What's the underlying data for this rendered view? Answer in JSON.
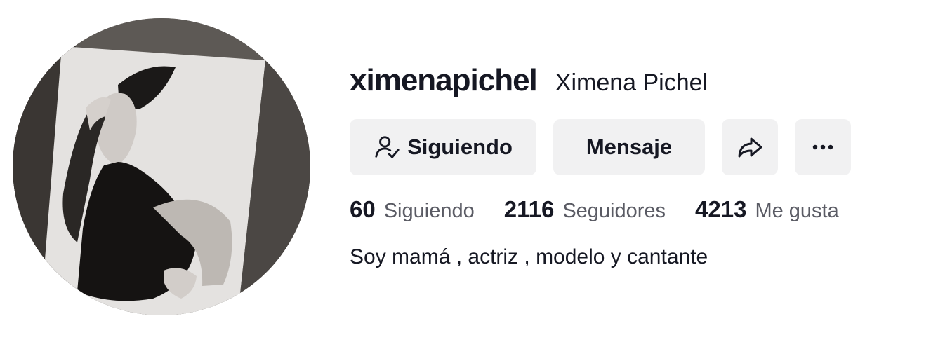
{
  "profile": {
    "username": "ximenapichel",
    "nickname": "Ximena Pichel",
    "bio": "Soy mamá , actriz , modelo y cantante",
    "avatar_icon": "profile-photo"
  },
  "actions": {
    "follow_label": "Siguiendo",
    "follow_icon": "user-check-icon",
    "message_label": "Mensaje",
    "share_icon": "share-arrow-icon",
    "more_icon": "ellipsis-icon"
  },
  "stats": {
    "following": {
      "count": "60",
      "label": "Siguiendo"
    },
    "followers": {
      "count": "2116",
      "label": "Seguidores"
    },
    "likes": {
      "count": "4213",
      "label": "Me gusta"
    }
  },
  "colors": {
    "text": "#161823",
    "secondary": "#5a5b64",
    "button_bg": "#f1f1f2"
  }
}
